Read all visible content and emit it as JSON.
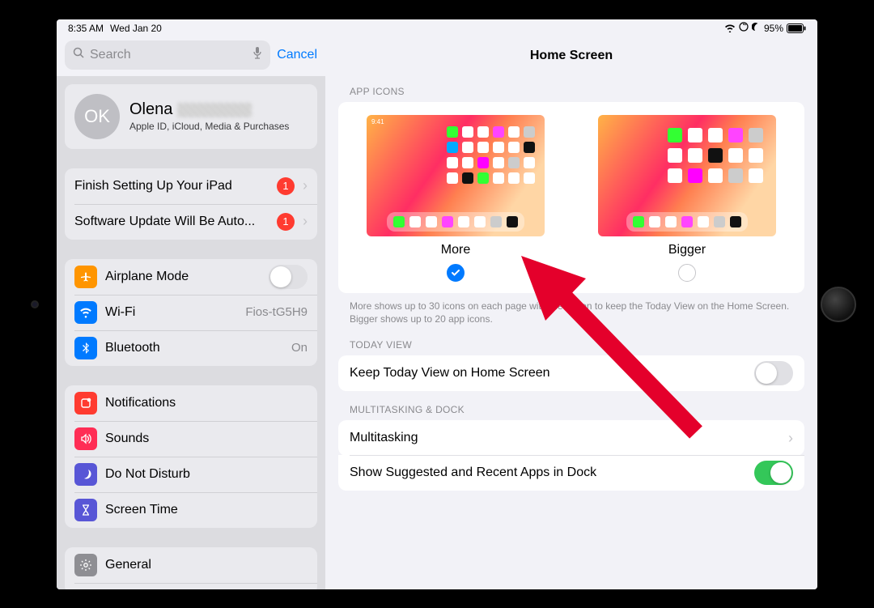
{
  "status": {
    "time": "8:35 AM",
    "date": "Wed Jan 20",
    "battery_pct": "95%"
  },
  "search": {
    "placeholder": "Search",
    "cancel": "Cancel"
  },
  "profile": {
    "initials": "OK",
    "first_name": "Olena",
    "subtitle": "Apple ID, iCloud, Media & Purchases"
  },
  "alerts": {
    "finish_setup": {
      "label": "Finish Setting Up Your iPad",
      "badge": "1"
    },
    "software_update": {
      "label": "Software Update Will Be Auto...",
      "badge": "1"
    }
  },
  "network": {
    "airplane": {
      "label": "Airplane Mode",
      "on": false
    },
    "wifi": {
      "label": "Wi-Fi",
      "value": "Fios-tG5H9"
    },
    "bluetooth": {
      "label": "Bluetooth",
      "value": "On"
    }
  },
  "prefs": {
    "notifications": "Notifications",
    "sounds": "Sounds",
    "dnd": "Do Not Disturb",
    "screentime": "Screen Time"
  },
  "general": {
    "label": "General"
  },
  "detail": {
    "title": "Home Screen",
    "app_icons_header": "APP ICONS",
    "more": {
      "label": "More",
      "selected": true
    },
    "bigger": {
      "label": "Bigger",
      "selected": false
    },
    "note": "More shows up to 30 icons on each page with the option to keep the Today View on the Home Screen. Bigger shows up to 20 app icons.",
    "today_header": "TODAY VIEW",
    "today_row": {
      "label": "Keep Today View on Home Screen",
      "on": false
    },
    "multi_header": "MULTITASKING & DOCK",
    "multitasking": "Multitasking",
    "suggested": {
      "label": "Show Suggested and Recent Apps in Dock",
      "on": true
    }
  },
  "icon_colors": {
    "airplane": "#ff9500",
    "wifi": "#007aff",
    "bluetooth": "#007aff",
    "notifications": "#ff3b30",
    "sounds": "#ff2d55",
    "dnd": "#5856d6",
    "screentime": "#5856d6",
    "general": "#8e8e93"
  }
}
